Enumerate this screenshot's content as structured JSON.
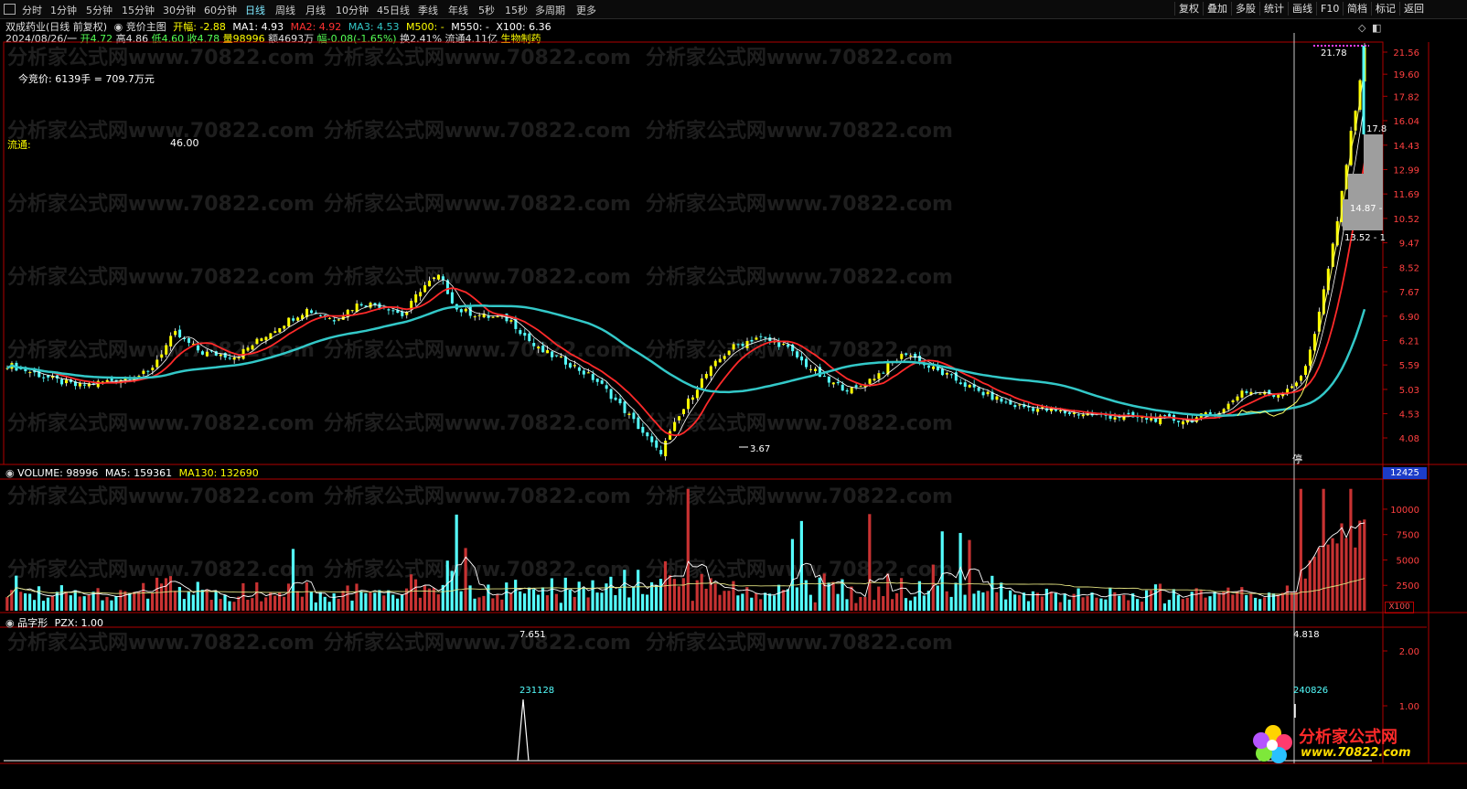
{
  "toolbar": {
    "icon": "chart-toggle-icon",
    "periods": [
      "分时",
      "1分钟",
      "5分钟",
      "15分钟",
      "30分钟",
      "60分钟",
      "日线",
      "周线",
      "月线",
      "10分钟",
      "45日线",
      "季线",
      "年线",
      "5秒",
      "15秒",
      "多周期",
      "更多"
    ],
    "active_period": "日线",
    "right_buttons": [
      "复权",
      "叠加",
      "多股",
      "统计",
      "画线",
      "F10",
      "简档",
      "标记",
      "返回"
    ]
  },
  "header": {
    "stock": "双成药业(日线 前复权)",
    "indicator": "竞价主图",
    "open_change": "开幅: -2.88",
    "ma1": "MA1: 4.93",
    "ma2": "MA2: 4.92",
    "ma3": "MA3: 4.53",
    "m500": "M500: -",
    "m550": "M550: -",
    "x100": "X100: 6.36"
  },
  "quote": {
    "date": "2024/08/26/一",
    "open": "开4.72",
    "high": "高4.86",
    "low": "低4.60",
    "close": "收4.78",
    "volume": "量98996",
    "amount": "额4693万",
    "change": "幅-0.08(-1.65%)",
    "turnover": "换2.41%",
    "float": "流通4.11亿",
    "sector": "生物制药"
  },
  "annotations": {
    "auction": "今竞价: 6139手 = 709.7万元",
    "float_label": "流通:",
    "float_value": "46.00",
    "low_label": "3.67",
    "high_label": "21.78",
    "label_178": "17.8",
    "label_1487": "14.87 -",
    "label_1352": "13.52 - 1",
    "stop_label": "停"
  },
  "watermark": "分析家公式网www.70822.com",
  "volume_panel": {
    "title": "VOLUME: 98996",
    "ma5": "MA5: 159361",
    "ma130": "MA130: 132690",
    "corner_value": "12425",
    "unit": "X100"
  },
  "pzx_panel": {
    "title": "品字形",
    "pzx": "PZX: 1.00",
    "peak1_value": "7.651",
    "peak1_date": "231128",
    "peak2_value": "4.818",
    "peak2_date": "240826"
  },
  "logo": {
    "text": "分析家公式网",
    "url": "www.70822.com"
  },
  "colors": {
    "up": "#ff3232",
    "down": "#54ffff",
    "ma1": "#ffffff",
    "ma2": "#ff2a2a",
    "ma3": "#33c8c8",
    "yellow": "#ffff00"
  },
  "chart_data": [
    {
      "type": "candlestick",
      "title": "竞价主图",
      "y_ticks": [
        21.56,
        19.6,
        17.82,
        16.04,
        14.43,
        12.99,
        11.69,
        10.52,
        9.47,
        8.52,
        7.67,
        6.9,
        6.21,
        5.59,
        5.03,
        4.53,
        4.08
      ],
      "log_scale": true,
      "series": [
        {
          "name": "MA1",
          "values": [
            4.93
          ]
        },
        {
          "name": "MA2",
          "values": [
            4.92
          ]
        },
        {
          "name": "MA3",
          "values": [
            4.53
          ]
        }
      ],
      "annotated_points": [
        {
          "label": "3.67",
          "y": 3.67
        },
        {
          "label": "21.78",
          "y": 21.78
        }
      ]
    },
    {
      "type": "bar",
      "title": "VOLUME",
      "y_ticks": [
        10000,
        7500,
        5000,
        2500
      ],
      "unit": "X100",
      "series": [
        {
          "name": "VOLUME",
          "values": [
            98996
          ]
        },
        {
          "name": "MA5",
          "values": [
            159361
          ]
        },
        {
          "name": "MA130",
          "values": [
            132690
          ]
        }
      ]
    },
    {
      "type": "line",
      "title": "品字形",
      "y_ticks": [
        2.0,
        1.0
      ],
      "series": [
        {
          "name": "PZX",
          "values": [
            1.0
          ]
        }
      ],
      "annotated_points": [
        {
          "label": "231128",
          "y": 7.651
        },
        {
          "label": "240826",
          "y": 4.818
        }
      ]
    }
  ]
}
